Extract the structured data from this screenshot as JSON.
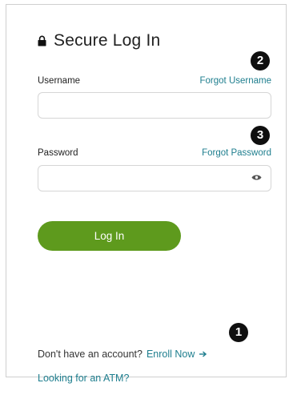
{
  "title": {
    "text": "Secure Log In",
    "icon": "lock-icon"
  },
  "badges": {
    "one": "1",
    "two": "2",
    "three": "3"
  },
  "username": {
    "label": "Username",
    "value": "",
    "placeholder": "",
    "forgot_link": "Forgot Username"
  },
  "password": {
    "label": "Password",
    "value": "",
    "placeholder": "",
    "forgot_link": "Forgot Password",
    "toggle_icon": "eye-icon"
  },
  "login_button": {
    "label": "Log In"
  },
  "enroll": {
    "prompt": "Don't have an account?",
    "link": "Enroll Now",
    "icon": "arrow-right-icon"
  },
  "atm_link": "Looking for an ATM?",
  "colors": {
    "accent_green": "#5e9a1d",
    "link_teal": "#1e7e8e",
    "badge_black": "#0f0f0f",
    "text_dark": "#222222",
    "border_gray": "#d6d6d6"
  }
}
